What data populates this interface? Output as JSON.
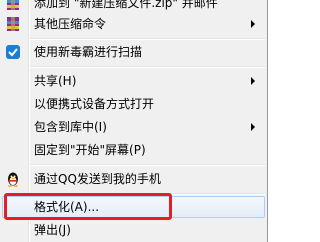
{
  "context_menu": {
    "items": [
      {
        "label": "添加到 \"新建压缩文件.zip\" 并邮件",
        "icon": "winrar-archive-icon",
        "has_submenu": false
      },
      {
        "label": "其他压缩命令",
        "icon": "winrar-archive-icon",
        "has_submenu": true
      },
      {
        "label": "使用新毒霸进行扫描",
        "icon": "antivirus-shield-icon",
        "has_submenu": false
      },
      {
        "label": "共享(H)",
        "icon": "",
        "has_submenu": true
      },
      {
        "label": "以便携式设备方式打开",
        "icon": "",
        "has_submenu": false
      },
      {
        "label": "包含到库中(I)",
        "icon": "",
        "has_submenu": true
      },
      {
        "label": "固定到\"开始\"屏幕(P)",
        "icon": "",
        "has_submenu": false
      },
      {
        "label": "通过QQ发送到我的手机",
        "icon": "qq-penguin-icon",
        "has_submenu": false
      },
      {
        "label": "格式化(A)...",
        "icon": "",
        "has_submenu": false,
        "highlighted": true
      },
      {
        "label": "弹出(J)",
        "icon": "",
        "has_submenu": false
      }
    ]
  },
  "annotation": {
    "callout_color": "#e31e24"
  },
  "colors": {
    "menu_background": "#f0f0f0",
    "highlight_border": "#aecff7",
    "accent_red": "#e31e24"
  }
}
